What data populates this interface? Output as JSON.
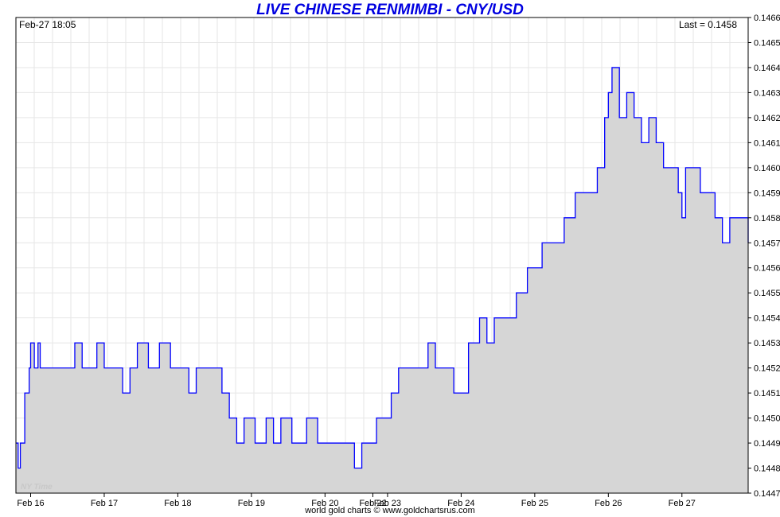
{
  "title": "LIVE CHINESE RENMIMBI - CNY/USD",
  "header_left": "Feb-27  18:05",
  "header_right": "Last = 0.1458",
  "watermark": "NY Time",
  "footer": "world gold charts © www.goldchartsrus.com",
  "colors": {
    "line": "#0000ff",
    "fill": "#d6d6d6",
    "grid": "#e6e6e6",
    "title": "#0000e0"
  },
  "chart_data": {
    "type": "area",
    "title": "LIVE CHINESE RENMIMBI - CNY/USD",
    "xlabel": "",
    "ylabel": "",
    "ylim": [
      0.1447,
      0.1466
    ],
    "grid": true,
    "y_ticks": [
      "0.1447",
      "0.1448",
      "0.1449",
      "0.1450",
      "0.1451",
      "0.1452",
      "0.1453",
      "0.1454",
      "0.1455",
      "0.1456",
      "0.1457",
      "0.1458",
      "0.1459",
      "0.1460",
      "0.1461",
      "0.1462",
      "0.1463",
      "0.1464",
      "0.1465",
      "0.1466"
    ],
    "x_ticks": [
      {
        "label": "Feb 16",
        "x": 0.2
      },
      {
        "label": "Feb 17",
        "x": 1.2
      },
      {
        "label": "Feb 18",
        "x": 2.2
      },
      {
        "label": "Feb 19",
        "x": 3.2
      },
      {
        "label": "Feb 20",
        "x": 4.2
      },
      {
        "label": "Feb 22",
        "x": 4.85
      },
      {
        "label": "Feb 23",
        "x": 5.05
      },
      {
        "label": "Feb 24",
        "x": 6.05
      },
      {
        "label": "Feb 25",
        "x": 7.05
      },
      {
        "label": "Feb 26",
        "x": 8.05
      },
      {
        "label": "Feb 27",
        "x": 9.05
      }
    ],
    "xlim": [
      0,
      9.95
    ],
    "series": [
      {
        "x": [
          0,
          0.03,
          0.06,
          0.12,
          0.18,
          0.2,
          0.25,
          0.3,
          0.33,
          0.4,
          0.45,
          0.5,
          0.6,
          0.8,
          0.9,
          1.0,
          1.1,
          1.2,
          1.35,
          1.45,
          1.55,
          1.65,
          1.8,
          1.95,
          2.1,
          2.2,
          2.35,
          2.45,
          2.6,
          2.8,
          2.9,
          3.0,
          3.1,
          3.25,
          3.4,
          3.5,
          3.6,
          3.75,
          3.85,
          3.95,
          4.1,
          4.2,
          4.35,
          4.5,
          4.6,
          4.7,
          4.8,
          4.9,
          5.0,
          5.1,
          5.2,
          5.35,
          5.45,
          5.6,
          5.7,
          5.8,
          5.95,
          6.05,
          6.15,
          6.3,
          6.4,
          6.5,
          6.65,
          6.8,
          6.95,
          7.05,
          7.15,
          7.3,
          7.45,
          7.6,
          7.75,
          7.9,
          8.0,
          8.05,
          8.1,
          8.2,
          8.3,
          8.4,
          8.5,
          8.6,
          8.7,
          8.8,
          8.9,
          9.0,
          9.05,
          9.1,
          9.2,
          9.3,
          9.4,
          9.5,
          9.6,
          9.7,
          9.8,
          9.9,
          9.95
        ],
        "y": [
          0.1449,
          0.1448,
          0.1449,
          0.1451,
          0.1452,
          0.1453,
          0.1452,
          0.1453,
          0.1452,
          0.1452,
          0.1452,
          0.1452,
          0.1452,
          0.1453,
          0.1452,
          0.1452,
          0.1453,
          0.1452,
          0.1452,
          0.1451,
          0.1452,
          0.1453,
          0.1452,
          0.1453,
          0.1452,
          0.1452,
          0.1451,
          0.1452,
          0.1452,
          0.1451,
          0.145,
          0.1449,
          0.145,
          0.1449,
          0.145,
          0.1449,
          0.145,
          0.1449,
          0.1449,
          0.145,
          0.1449,
          0.1449,
          0.1449,
          0.1449,
          0.1448,
          0.1449,
          0.1449,
          0.145,
          0.145,
          0.1451,
          0.1452,
          0.1452,
          0.1452,
          0.1453,
          0.1452,
          0.1452,
          0.1451,
          0.1451,
          0.1453,
          0.1454,
          0.1453,
          0.1454,
          0.1454,
          0.1455,
          0.1456,
          0.1456,
          0.1457,
          0.1457,
          0.1458,
          0.1459,
          0.1459,
          0.146,
          0.1462,
          0.1463,
          0.1464,
          0.1462,
          0.1463,
          0.1462,
          0.1461,
          0.1462,
          0.1461,
          0.146,
          0.146,
          0.1459,
          0.1458,
          0.146,
          0.146,
          0.1459,
          0.1459,
          0.1458,
          0.1457,
          0.1458,
          0.1458,
          0.1458,
          0.1457
        ]
      }
    ]
  }
}
